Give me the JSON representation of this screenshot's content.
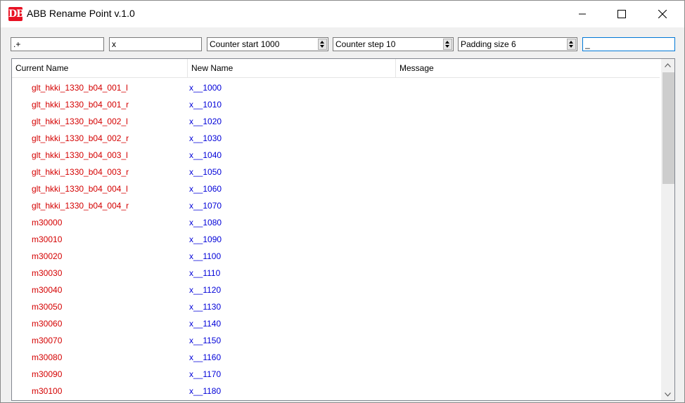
{
  "window": {
    "icon_text": "DB",
    "title": "ABB Rename Point v.1.0"
  },
  "toolbar": {
    "pattern_value": ".+",
    "prefix_value": "x",
    "counter_start_label": "Counter start 1000",
    "counter_step_label": "Counter step 10",
    "padding_size_label": "Padding size 6",
    "separator_value": "_"
  },
  "grid": {
    "columns": [
      "Current Name",
      "New Name",
      "Message"
    ],
    "rows": [
      {
        "current": "glt_hkki_1330_b04_001_l",
        "new": "x__1000"
      },
      {
        "current": "glt_hkki_1330_b04_001_r",
        "new": "x__1010"
      },
      {
        "current": "glt_hkki_1330_b04_002_l",
        "new": "x__1020"
      },
      {
        "current": "glt_hkki_1330_b04_002_r",
        "new": "x__1030"
      },
      {
        "current": "glt_hkki_1330_b04_003_l",
        "new": "x__1040"
      },
      {
        "current": "glt_hkki_1330_b04_003_r",
        "new": "x__1050"
      },
      {
        "current": "glt_hkki_1330_b04_004_l",
        "new": "x__1060"
      },
      {
        "current": "glt_hkki_1330_b04_004_r",
        "new": "x__1070"
      },
      {
        "current": "m30000",
        "new": "x__1080"
      },
      {
        "current": "m30010",
        "new": "x__1090"
      },
      {
        "current": "m30020",
        "new": "x__1100"
      },
      {
        "current": "m30030",
        "new": "x__1110"
      },
      {
        "current": "m30040",
        "new": "x__1120"
      },
      {
        "current": "m30050",
        "new": "x__1130"
      },
      {
        "current": "m30060",
        "new": "x__1140"
      },
      {
        "current": "m30070",
        "new": "x__1150"
      },
      {
        "current": "m30080",
        "new": "x__1160"
      },
      {
        "current": "m30090",
        "new": "x__1170"
      },
      {
        "current": "m30100",
        "new": "x__1180"
      }
    ]
  },
  "colors": {
    "current_name": "#d40000",
    "new_name": "#0000d8",
    "app_icon": "#e81123",
    "focus_border": "#0078d7"
  },
  "icons": {
    "minimize": "minimize-icon",
    "maximize": "maximize-icon",
    "close": "close-icon",
    "scroll_up": "chevron-up-icon",
    "scroll_down": "chevron-down-icon"
  }
}
